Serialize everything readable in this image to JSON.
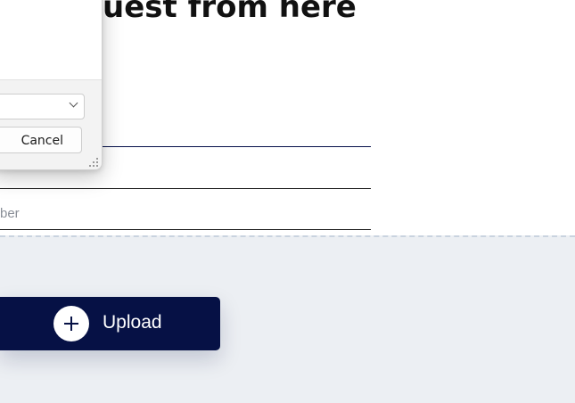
{
  "page": {
    "heading": "uest from here",
    "field_placeholder": "ber"
  },
  "upload": {
    "label": "Upload",
    "icon": "plus-icon"
  },
  "dialog": {
    "cancel_label": "Cancel",
    "select_icon": "chevron-down-icon",
    "resize_icon": "resize-grip-icon"
  },
  "colors": {
    "primary": "#061145",
    "drop_zone_bg": "#eceff3",
    "dashed_border": "#c9d3df",
    "dialog_bg": "#f3f3f3"
  }
}
